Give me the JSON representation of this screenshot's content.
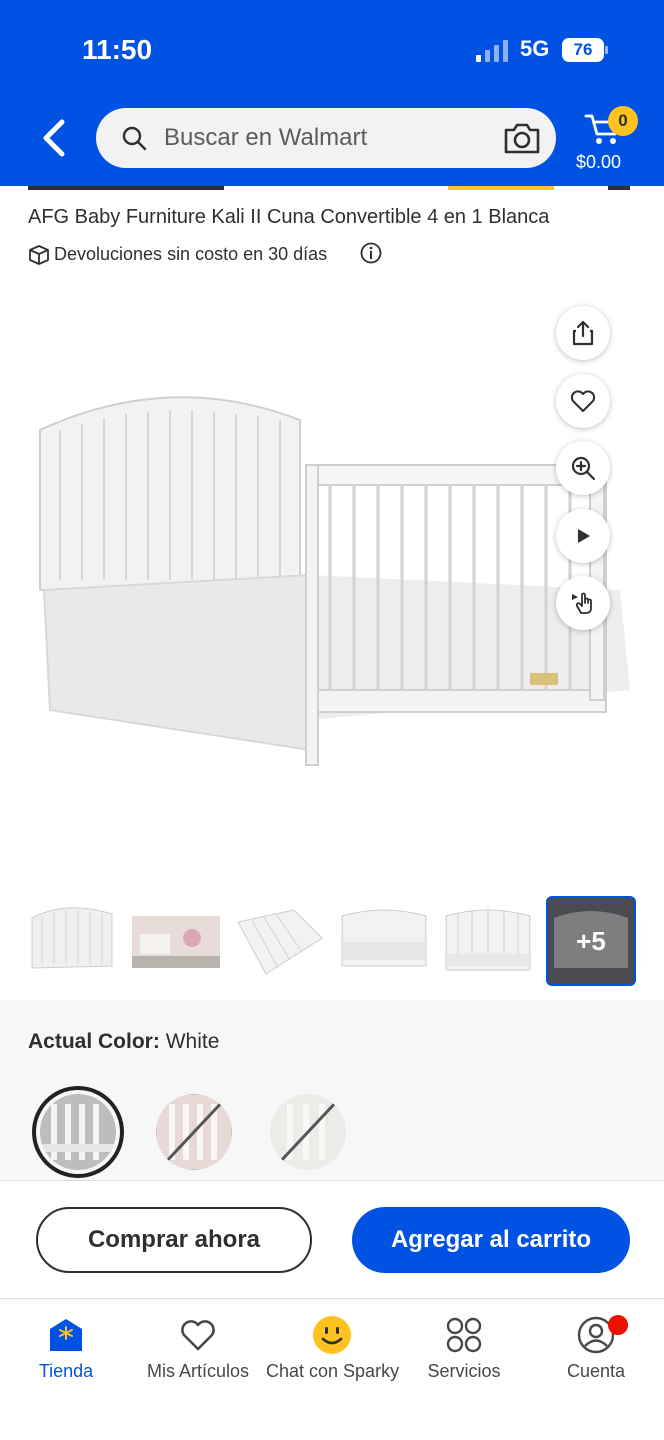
{
  "status_bar": {
    "time": "11:50",
    "network": "5G",
    "battery": "76"
  },
  "header": {
    "search": {
      "placeholder": "Buscar en Walmart"
    },
    "cart": {
      "count": "0",
      "total": "$0.00"
    }
  },
  "product": {
    "title": "AFG Baby Furniture Kali II Cuna Convertible 4 en 1 Blanca",
    "returns": "Devoluciones sin costo en 30 días",
    "more_images": "+5"
  },
  "color": {
    "label": "Actual Color:",
    "value": "White",
    "swatches": [
      {
        "name": "White",
        "selected": true,
        "available": true
      },
      {
        "name": "Pink",
        "selected": false,
        "available": false
      },
      {
        "name": "Light",
        "selected": false,
        "available": false
      }
    ]
  },
  "actions": {
    "buy_now": "Comprar ahora",
    "add_to_cart": "Agregar al carrito"
  },
  "tabs": [
    {
      "label": "Tienda",
      "icon": "store-icon",
      "active": true
    },
    {
      "label": "Mis Artículos",
      "icon": "heart-icon",
      "active": false
    },
    {
      "label": "Chat con Sparky",
      "icon": "sparky-icon",
      "active": false
    },
    {
      "label": "Servicios",
      "icon": "services-icon",
      "active": false
    },
    {
      "label": "Cuenta",
      "icon": "account-icon",
      "active": false
    }
  ],
  "colors": {
    "brand": "#0053e2",
    "accent": "#ffc220",
    "notification": "#ea1100"
  }
}
